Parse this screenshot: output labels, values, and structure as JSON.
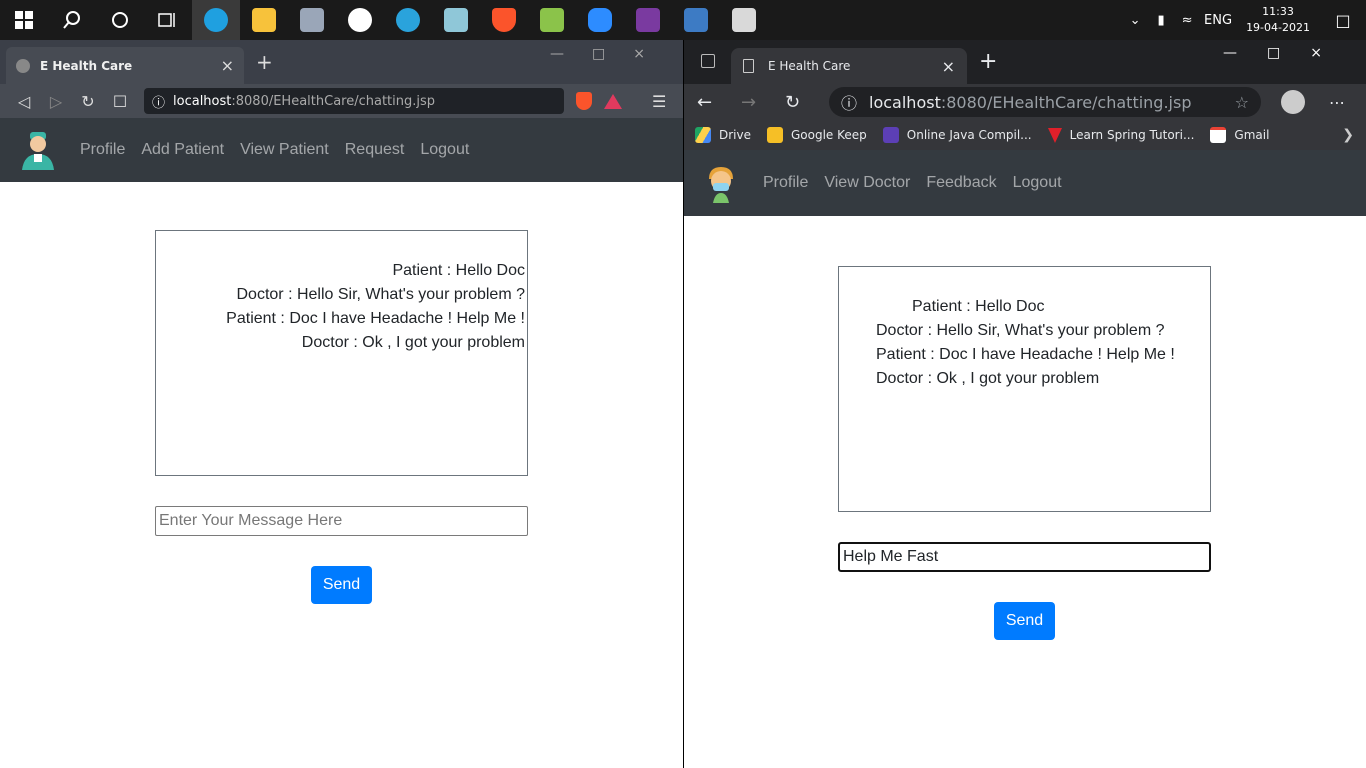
{
  "taskbar": {
    "apps": [
      {
        "name": "windows-start-icon",
        "color": "#ffffff"
      },
      {
        "name": "search-icon",
        "color": "#ffffff"
      },
      {
        "name": "cortana-icon",
        "color": "#ffffff"
      },
      {
        "name": "task-view-icon",
        "color": "#ffffff"
      },
      {
        "name": "edge-icon",
        "color": "#1fa0e0"
      },
      {
        "name": "file-explorer-icon",
        "color": "#f7c23b"
      },
      {
        "name": "app-icon",
        "color": "#9aa6b8"
      },
      {
        "name": "app-w-icon",
        "color": "#ffffff"
      },
      {
        "name": "telegram-icon",
        "color": "#2aa3dc"
      },
      {
        "name": "notes-icon",
        "color": "#8fc7d8"
      },
      {
        "name": "brave-icon",
        "color": "#fb542b"
      },
      {
        "name": "notepad-icon",
        "color": "#8bc34a"
      },
      {
        "name": "zoom-icon",
        "color": "#2d8cff"
      },
      {
        "name": "game-icon",
        "color": "#7a3aa0"
      },
      {
        "name": "photos-icon",
        "color": "#3d7bc4"
      },
      {
        "name": "presentation-icon",
        "color": "#d9d9d9"
      }
    ],
    "tray": {
      "language": "ENG",
      "time": "11:33",
      "date": "19-04-2021"
    }
  },
  "left_browser": {
    "tab_title": "E Health Care",
    "url_host": "localhost",
    "url_path": ":8080/EHealthCare/chatting.jsp",
    "nav_links": [
      "Profile",
      "Add Patient",
      "View Patient",
      "Request",
      "Logout"
    ],
    "messages": [
      "Patient : Hello Doc",
      "Doctor : Hello Sir, What's your problem ?",
      "Patient : Doc I have Headache ! Help Me !",
      "Doctor : Ok , I got your problem"
    ],
    "input_placeholder": "Enter Your Message Here",
    "send_label": "Send"
  },
  "right_browser": {
    "tab_title": "E Health Care",
    "url_host": "localhost",
    "url_path": ":8080/EHealthCare/chatting.jsp",
    "bookmarks": [
      "Drive",
      "Google Keep",
      "Online Java Compil...",
      "Learn Spring Tutori...",
      "Gmail"
    ],
    "nav_links": [
      "Profile",
      "View Doctor",
      "Feedback",
      "Logout"
    ],
    "messages": [
      "Patient : Hello Doc",
      "Doctor : Hello Sir, What's your problem ?",
      "Patient : Doc I have Headache ! Help Me !",
      "Doctor : Ok , I got your problem"
    ],
    "input_value": "Help Me Fast",
    "send_label": "Send"
  }
}
